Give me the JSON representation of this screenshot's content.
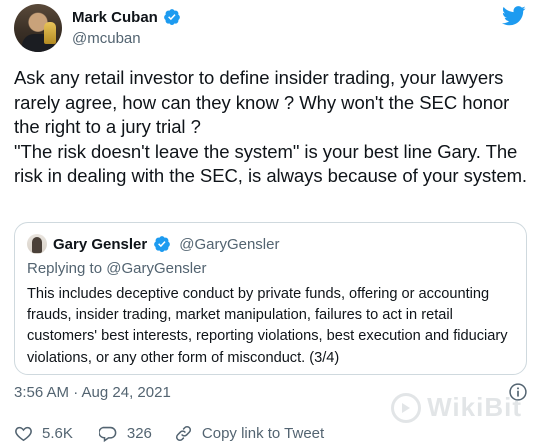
{
  "author": {
    "name": "Mark Cuban",
    "handle": "@mcuban"
  },
  "tweet": {
    "text": "Ask any retail investor to define insider trading, your lawyers rarely agree, how can they know ? Why won't the SEC honor the right to a jury trial ?\n\"The risk doesn't leave the system\" is your best line Gary. The risk in dealing with the SEC, is always because of your system."
  },
  "quoted": {
    "name": "Gary Gensler",
    "handle": "@GaryGensler",
    "replying_to": "Replying to @GaryGensler",
    "text": "This includes deceptive conduct by private funds, offering or accounting frauds, insider trading, market manipulation, failures to act in retail customers' best interests, reporting violations, best execution and fiduciary violations, or any other form of misconduct. (3/4)"
  },
  "meta": {
    "timestamp": "3:56 AM · Aug 24, 2021"
  },
  "actions": {
    "likes": "5.6K",
    "replies": "326",
    "copy_link": "Copy link to Tweet"
  },
  "watermark": {
    "text": "WikiBit"
  },
  "colors": {
    "twitter_blue": "#1d9bf0",
    "secondary_text": "#536471",
    "like_red": "#f91880",
    "border": "#cfd9de"
  },
  "icons": {
    "verified": "verified-badge-icon",
    "twitter": "twitter-bird-icon",
    "info": "info-icon",
    "like": "heart-icon",
    "reply": "speech-bubble-icon",
    "link": "link-icon"
  }
}
